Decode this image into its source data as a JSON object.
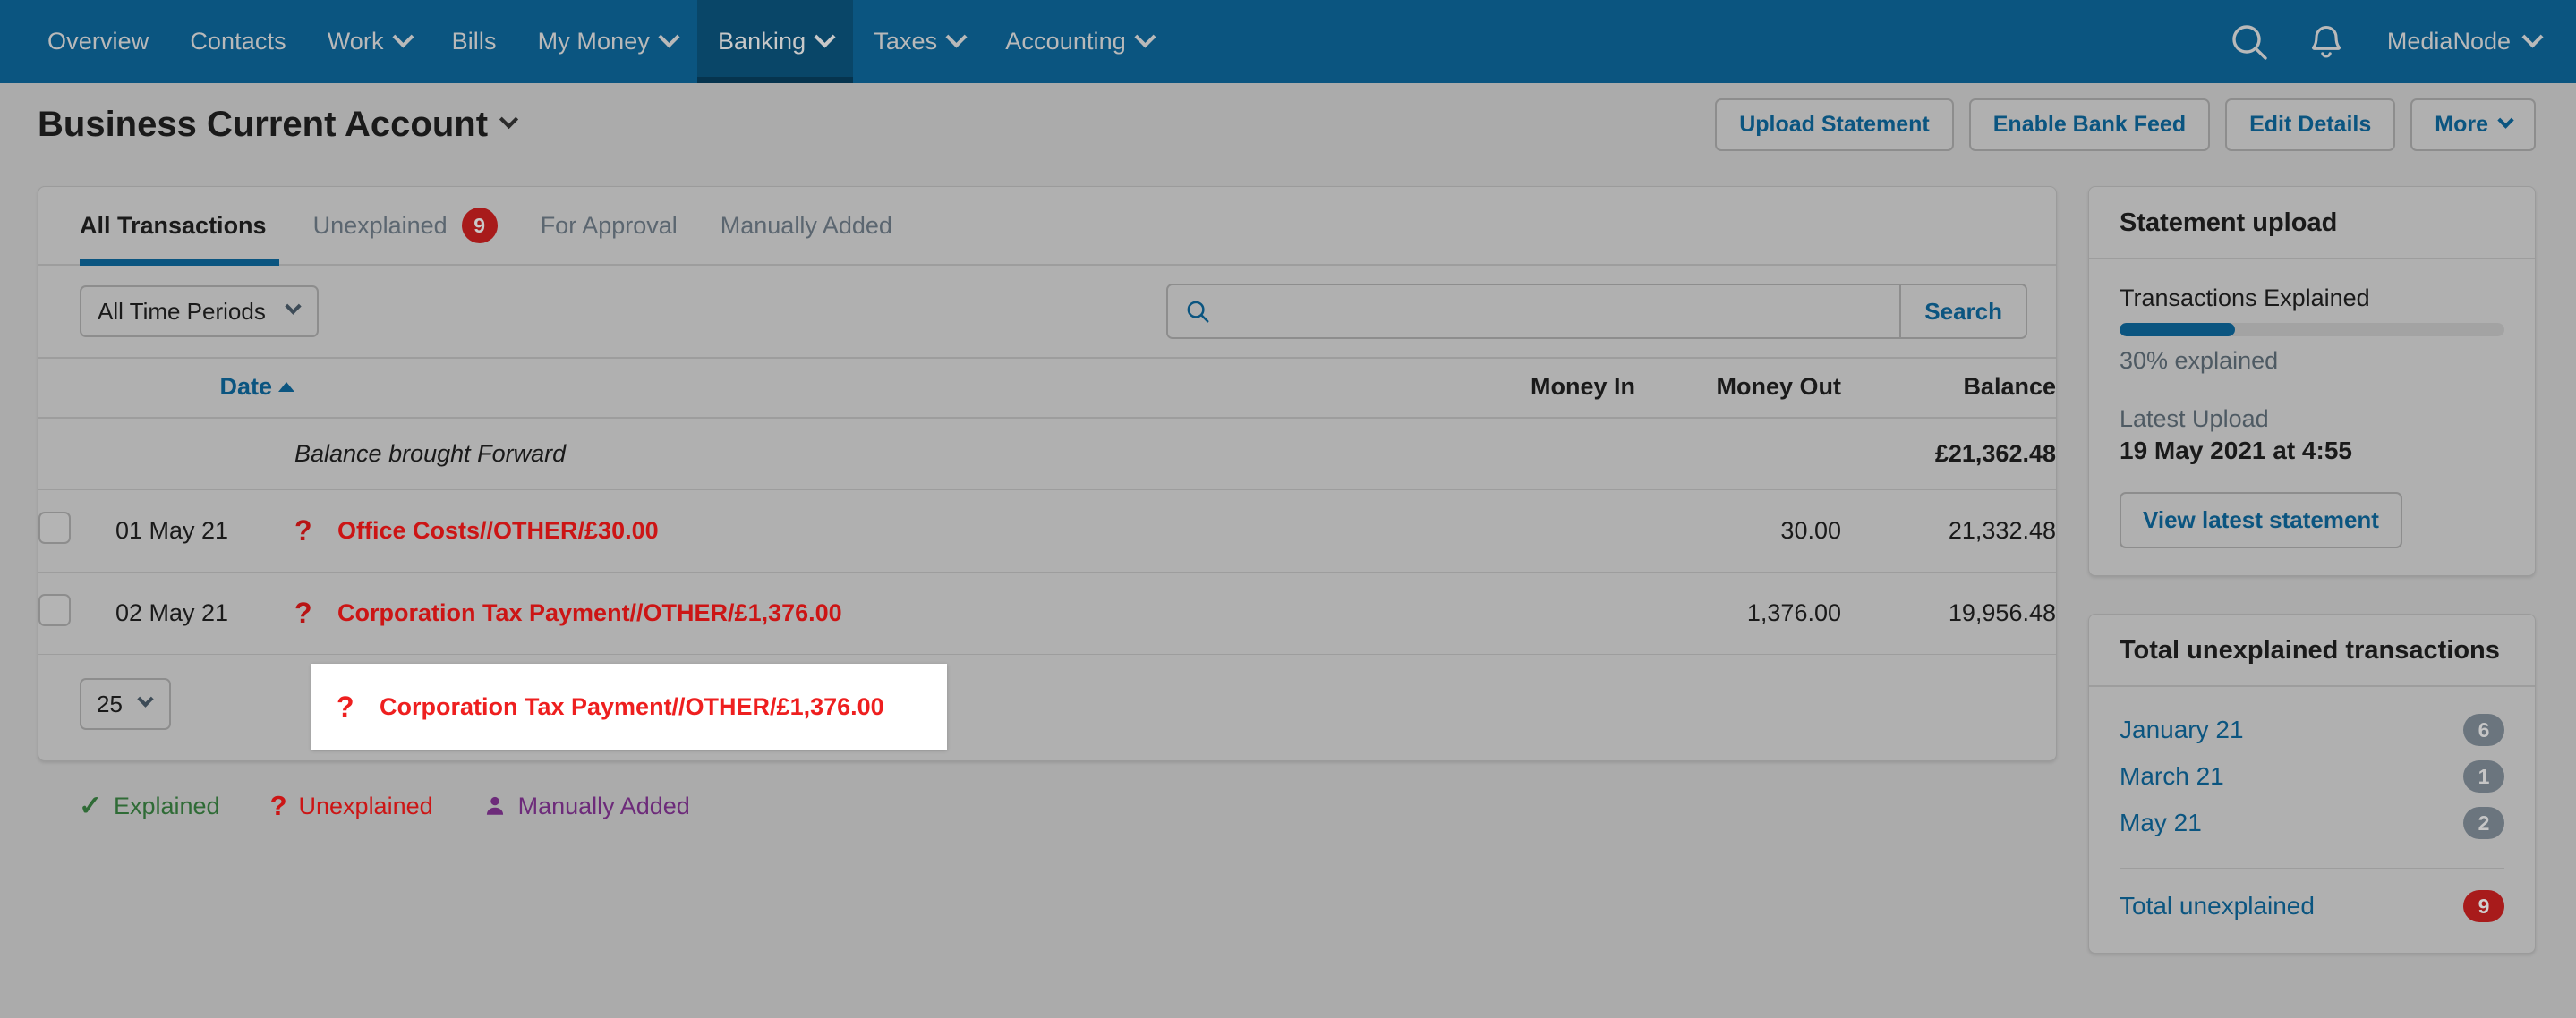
{
  "nav": {
    "items": [
      {
        "label": "Overview",
        "has_caret": false,
        "active": false
      },
      {
        "label": "Contacts",
        "has_caret": false,
        "active": false
      },
      {
        "label": "Work",
        "has_caret": true,
        "active": false
      },
      {
        "label": "Bills",
        "has_caret": false,
        "active": false
      },
      {
        "label": "My Money",
        "has_caret": true,
        "active": false
      },
      {
        "label": "Banking",
        "has_caret": true,
        "active": true
      },
      {
        "label": "Taxes",
        "has_caret": true,
        "active": false
      },
      {
        "label": "Accounting",
        "has_caret": true,
        "active": false
      }
    ],
    "search_icon": "search-icon",
    "bell_icon": "bell-icon",
    "user": "MediaNode"
  },
  "header": {
    "title": "Business Current Account",
    "buttons": [
      {
        "label": "Upload Statement",
        "caret": false
      },
      {
        "label": "Enable Bank Feed",
        "caret": false
      },
      {
        "label": "Edit Details",
        "caret": false
      },
      {
        "label": "More",
        "caret": true
      }
    ]
  },
  "tabs": [
    {
      "label": "All Transactions",
      "badge": "",
      "active": true
    },
    {
      "label": "Unexplained",
      "badge": "9",
      "active": false
    },
    {
      "label": "For Approval",
      "badge": "",
      "active": false
    },
    {
      "label": "Manually Added",
      "badge": "",
      "active": false
    }
  ],
  "filters": {
    "period_selected": "All Time Periods",
    "period_options": [
      "All Time Periods"
    ],
    "search_value": "",
    "search_placeholder": "",
    "search_button": "Search"
  },
  "table": {
    "headers": {
      "date": "Date",
      "money_in": "Money In",
      "money_out": "Money Out",
      "balance": "Balance"
    },
    "sort": "asc",
    "brought_forward": {
      "label": "Balance brought Forward",
      "balance": "£21,362.48"
    },
    "rows": [
      {
        "date": "01 May 21",
        "status_icon": "?",
        "description": "Office Costs//OTHER/£30.00",
        "money_in": "",
        "money_out": "30.00",
        "balance": "21,332.48"
      },
      {
        "date": "02 May 21",
        "status_icon": "?",
        "description": "Corporation Tax Payment//OTHER/£1,376.00",
        "money_in": "",
        "money_out": "1,376.00",
        "balance": "19,956.48"
      }
    ],
    "page_size": "25",
    "page_size_options": [
      "25"
    ]
  },
  "popup": {
    "status_icon": "?",
    "description": "Corporation Tax Payment//OTHER/£1,376.00"
  },
  "legend": [
    {
      "icon": "check-icon",
      "label": "Explained"
    },
    {
      "icon": "question-icon",
      "label": "Unexplained"
    },
    {
      "icon": "person-icon",
      "label": "Manually Added"
    }
  ],
  "sidebar": {
    "statement_upload": {
      "title": "Statement upload",
      "transactions_explained_label": "Transactions Explained",
      "progress_percent": 30,
      "progress_text": "30% explained",
      "latest_upload_label": "Latest Upload",
      "latest_upload_value": "19 May 2021 at 4:55",
      "view_statement_button": "View latest statement"
    },
    "unexplained": {
      "title": "Total unexplained transactions",
      "rows": [
        {
          "label": "January 21",
          "count": "6"
        },
        {
          "label": "March 21",
          "count": "1"
        },
        {
          "label": "May 21",
          "count": "2"
        }
      ],
      "total_label": "Total unexplained",
      "total_count": "9"
    }
  },
  "colors": {
    "nav_blue": "#0b5580",
    "nav_blue_active": "#094668",
    "link_blue": "#0b5580",
    "badge_red": "#a81b1b",
    "unexplained_red": "#cc1515",
    "explained_green": "#2f6b36",
    "manual_purple": "#6d2b7a",
    "page_bg": "#ababab"
  }
}
